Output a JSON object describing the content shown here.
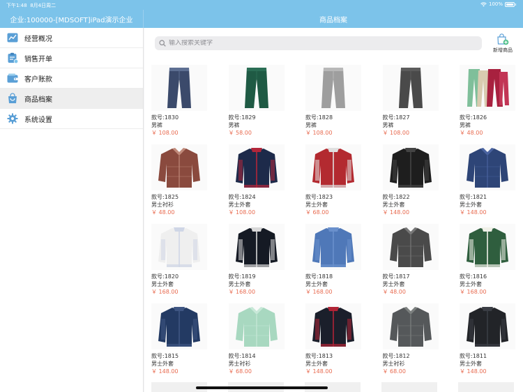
{
  "status": {
    "time": "下午1:48",
    "date": "8月4日周二",
    "battery": "100%"
  },
  "header": {
    "left_title": "企业:100000-[MDSOFT]iPad演示企业",
    "center_title": "商品档案"
  },
  "sidebar": {
    "items": [
      {
        "label": "经营概况",
        "icon": "chart-icon",
        "active": false
      },
      {
        "label": "销售开单",
        "icon": "clipboard-icon",
        "active": false
      },
      {
        "label": "客户账款",
        "icon": "wallet-icon",
        "active": false
      },
      {
        "label": "商品档案",
        "icon": "bag-icon",
        "active": true
      },
      {
        "label": "系统设置",
        "icon": "gear-icon",
        "active": false
      }
    ]
  },
  "search": {
    "placeholder": "输入搜索关键字",
    "value": ""
  },
  "add_product": {
    "label": "新增商品",
    "icon": "bag-plus-icon"
  },
  "colors": {
    "accent": "#7cc3ea",
    "price": "#e86a4f"
  },
  "products": [
    {
      "code": "款号:1830",
      "name": "男裤",
      "price": "￥ 108.00",
      "kind": "pants",
      "color": "#3b4a6b",
      "color2": "#5d6f92"
    },
    {
      "code": "款号:1829",
      "name": "男裤",
      "price": "￥ 58.00",
      "kind": "pants",
      "color": "#1f5a44",
      "color2": "#2b6e55"
    },
    {
      "code": "款号:1828",
      "name": "男裤",
      "price": "￥ 108.00",
      "kind": "pants",
      "color": "#9e9e9e",
      "color2": "#b8b8b8"
    },
    {
      "code": "款号:1827",
      "name": "男裤",
      "price": "￥ 108.00",
      "kind": "pants",
      "color": "#4a4a4a",
      "color2": "#5c5c5c"
    },
    {
      "code": "款号:1826",
      "name": "男裤",
      "price": "￥ 48.00",
      "kind": "pants-multi",
      "color": "#a8213f",
      "color2": "#7fbf9a"
    },
    {
      "code": "款号:1825",
      "name": "男士衬衫",
      "price": "￥ 48.00",
      "kind": "shirt",
      "color": "#8a4a3e",
      "color2": "#c08a7a"
    },
    {
      "code": "款号:1824",
      "name": "男士外套",
      "price": "￥ 108.00",
      "kind": "jacket",
      "color": "#1d2a4a",
      "color2": "#b3263a"
    },
    {
      "code": "款号:1823",
      "name": "男士外套",
      "price": "￥ 68.00",
      "kind": "jacket",
      "color": "#b32a30",
      "color2": "#e0e0e0"
    },
    {
      "code": "款号:1822",
      "name": "男士外套",
      "price": "￥ 148.00",
      "kind": "jacket",
      "color": "#1e1e1e",
      "color2": "#444444"
    },
    {
      "code": "款号:1821",
      "name": "男士外套",
      "price": "￥ 148.00",
      "kind": "shirt",
      "color": "#2e4577",
      "color2": "#4a63a0"
    },
    {
      "code": "款号:1820",
      "name": "男士外套",
      "price": "￥ 168.00",
      "kind": "jacket",
      "color": "#efefef",
      "color2": "#cfd6e6"
    },
    {
      "code": "款号:1819",
      "name": "男士外套",
      "price": "￥ 168.00",
      "kind": "jacket",
      "color": "#151a24",
      "color2": "#d8d8d8"
    },
    {
      "code": "款号:1818",
      "name": "男士外套",
      "price": "￥ 168.00",
      "kind": "jacket",
      "color": "#4f78b8",
      "color2": "#6a90cc"
    },
    {
      "code": "款号:1817",
      "name": "男士外套",
      "price": "￥ 48.00",
      "kind": "shirt",
      "color": "#4a4a4a",
      "color2": "#777777"
    },
    {
      "code": "款号:1816",
      "name": "男士外套",
      "price": "￥ 168.00",
      "kind": "jacket",
      "color": "#2f5e3e",
      "color2": "#f0f0e8"
    },
    {
      "code": "款号:1815",
      "name": "男士外套",
      "price": "￥ 148.00",
      "kind": "jacket",
      "color": "#233a63",
      "color2": "#3f5683"
    },
    {
      "code": "款号:1814",
      "name": "男士衬衫",
      "price": "￥ 68.00",
      "kind": "shirt",
      "color": "#a8d8c0",
      "color2": "#c8e8d8"
    },
    {
      "code": "款号:1813",
      "name": "男士外套",
      "price": "￥ 148.00",
      "kind": "jacket",
      "color": "#1b1f2b",
      "color2": "#b12436"
    },
    {
      "code": "款号:1812",
      "name": "男士衬衫",
      "price": "￥ 68.00",
      "kind": "shirt",
      "color": "#55585a",
      "color2": "#7c807f"
    },
    {
      "code": "款号:1811",
      "name": "男士外套",
      "price": "￥ 148.00",
      "kind": "jacket",
      "color": "#222428",
      "color2": "#3a3d44"
    }
  ]
}
